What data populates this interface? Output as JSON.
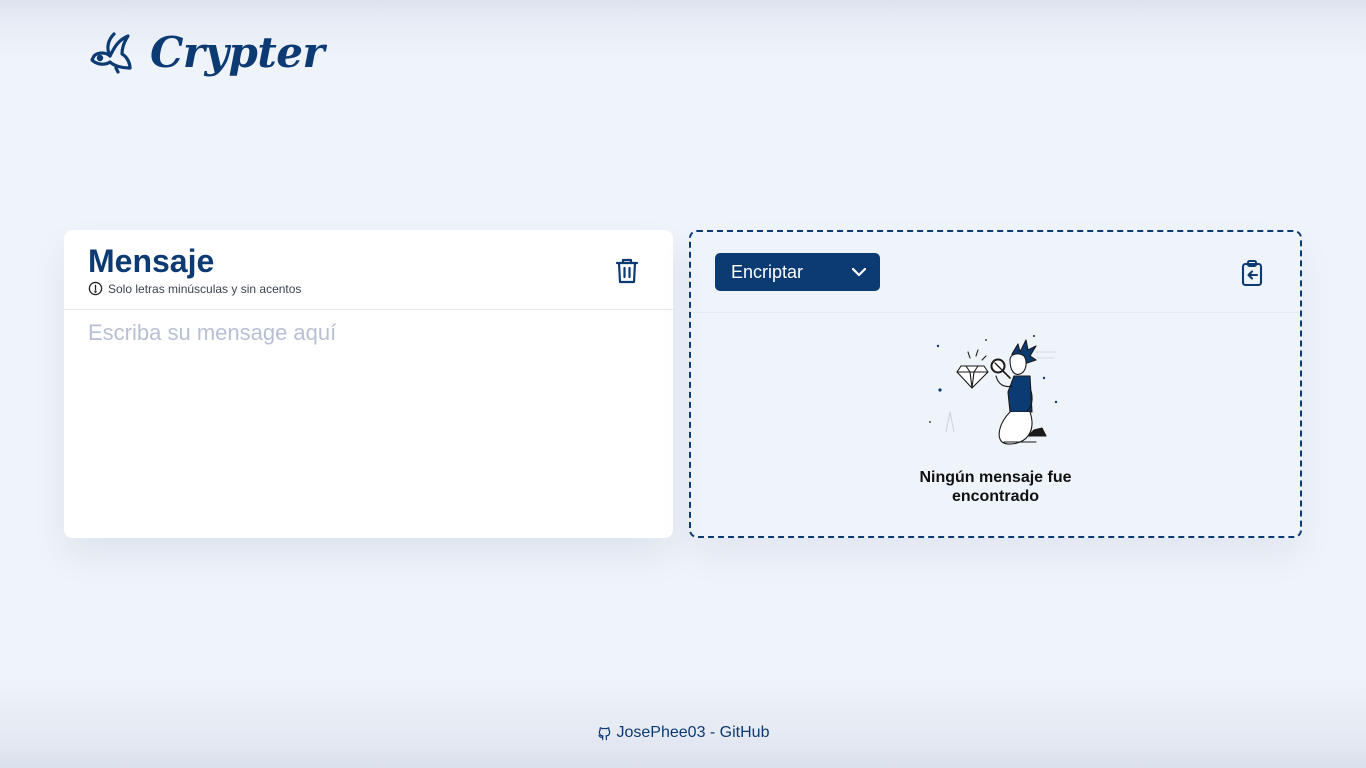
{
  "app": {
    "name": "Crypter",
    "logo_icon": "bird-icon"
  },
  "input_panel": {
    "title": "Mensaje",
    "hint": "Solo letras minúsculas y sin acentos",
    "hint_icon": "info-icon",
    "placeholder": "Escriba su mensage aquí",
    "value": "",
    "clear_icon": "trash-icon"
  },
  "output_panel": {
    "mode": {
      "selected": "Encriptar"
    },
    "copy_icon": "clipboard-icon",
    "empty_state": {
      "illustration": "person-with-magnifier-illustration",
      "text": "Ningún mensaje fue encontrado"
    }
  },
  "footer": {
    "link_text": "JosePhee03 - GitHub",
    "link_icon": "github-icon"
  },
  "colors": {
    "brand": "#0c3a72",
    "background": "#eff3fa",
    "card": "#ffffff",
    "placeholder": "#b9c0d4"
  }
}
